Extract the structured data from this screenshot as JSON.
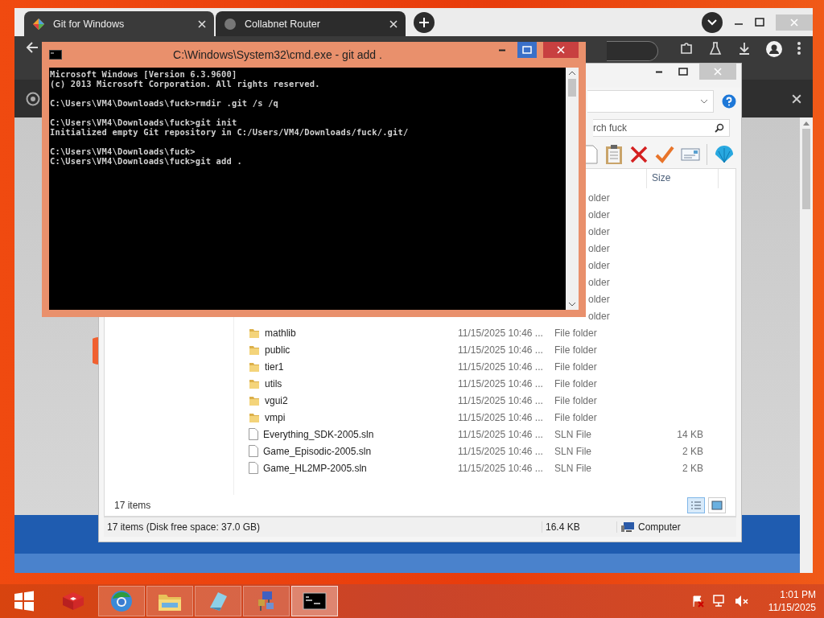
{
  "browser": {
    "tabs": [
      {
        "title": "Git for Windows",
        "selected": true
      },
      {
        "title": "Collabnet Router",
        "selected": false
      }
    ]
  },
  "explorer": {
    "search": {
      "value": "rch fuck"
    },
    "columns": [
      {
        "label": "Size"
      }
    ],
    "hidden_rows": [
      {
        "type": "older"
      },
      {
        "type": "older"
      },
      {
        "type": "older"
      },
      {
        "type": "older"
      },
      {
        "type": "older"
      },
      {
        "type": "older"
      },
      {
        "type": "older"
      },
      {
        "type": "older"
      }
    ],
    "rows": [
      {
        "kind": "folder",
        "name": "mathlib",
        "date": "11/15/2025 10:46 ...",
        "type": "File folder"
      },
      {
        "kind": "folder",
        "name": "public",
        "date": "11/15/2025 10:46 ...",
        "type": "File folder"
      },
      {
        "kind": "folder",
        "name": "tier1",
        "date": "11/15/2025 10:46 ...",
        "type": "File folder"
      },
      {
        "kind": "folder",
        "name": "utils",
        "date": "11/15/2025 10:46 ...",
        "type": "File folder"
      },
      {
        "kind": "folder",
        "name": "vgui2",
        "date": "11/15/2025 10:46 ...",
        "type": "File folder"
      },
      {
        "kind": "folder",
        "name": "vmpi",
        "date": "11/15/2025 10:46 ...",
        "type": "File folder"
      },
      {
        "kind": "file",
        "name": "Everything_SDK-2005.sln",
        "date": "11/15/2025 10:46 ...",
        "type": "SLN File",
        "size": "14 KB"
      },
      {
        "kind": "file",
        "name": "Game_Episodic-2005.sln",
        "date": "11/15/2025 10:46 ...",
        "type": "SLN File",
        "size": "2 KB"
      },
      {
        "kind": "file",
        "name": "Game_HL2MP-2005.sln",
        "date": "11/15/2025 10:46 ...",
        "type": "SLN File",
        "size": "2 KB"
      }
    ],
    "item_count": "17 items",
    "status": {
      "summary": "17 items (Disk free space: 37.0 GB)",
      "size": "16.4 KB",
      "location": "Computer"
    }
  },
  "console": {
    "title": "C:\\Windows\\System32\\cmd.exe - git  add .",
    "blocks": [
      [
        "Microsoft Windows [Version 6.3.9600]",
        "(c) 2013 Microsoft Corporation. All rights reserved."
      ],
      [
        "C:\\Users\\VM4\\Downloads\\fuck>rmdir .git /s /q"
      ],
      [
        "C:\\Users\\VM4\\Downloads\\fuck>git init",
        "Initialized empty Git repository in C:/Users/VM4/Downloads/fuck/.git/"
      ],
      [
        "C:\\Users\\VM4\\Downloads\\fuck>",
        "C:\\Users\\VM4\\Downloads\\fuck>git add ."
      ]
    ]
  },
  "taskbar": {
    "apps": [
      {
        "kind": "box",
        "running": false,
        "selected": false
      },
      {
        "kind": "browser",
        "running": true,
        "selected": false
      },
      {
        "kind": "folder",
        "running": true,
        "selected": false
      },
      {
        "kind": "notepad",
        "running": true,
        "selected": false
      },
      {
        "kind": "network",
        "running": true,
        "selected": false
      },
      {
        "kind": "console",
        "running": true,
        "selected": true
      }
    ],
    "time": "1:01 PM",
    "date": "11/15/2025"
  }
}
